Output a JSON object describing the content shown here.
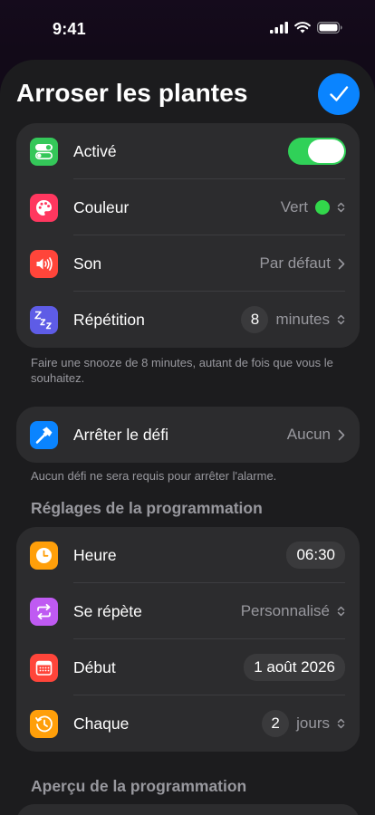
{
  "status": {
    "time": "9:41"
  },
  "header": {
    "title": "Arroser les plantes"
  },
  "settings": {
    "active_label": "Activé",
    "color_label": "Couleur",
    "color_value": "Vert",
    "sound_label": "Son",
    "sound_value": "Par défaut",
    "repeat_label": "Répétition",
    "repeat_number": "8",
    "repeat_unit": "minutes",
    "note": "Faire une snooze de 8 minutes, autant de fois que vous le souhaitez."
  },
  "challenge": {
    "label": "Arrêter le défi",
    "value": "Aucun",
    "note": "Aucun défi ne sera requis pour arrêter l'alarme."
  },
  "schedule": {
    "section_title": "Réglages de la programmation",
    "time_label": "Heure",
    "time_value": "06:30",
    "repeats_label": "Se répète",
    "repeats_value": "Personnalisé",
    "start_label": "Début",
    "start_value": "1 août 2026",
    "every_label": "Chaque",
    "every_number": "2",
    "every_unit": "jours"
  },
  "preview": {
    "section_title": "Aperçu de la programmation"
  },
  "colors": {
    "accent": "#0a84ff",
    "toggle_on": "#30d158",
    "color_dot": "#32d74b",
    "icon_active": "#34c759",
    "icon_color": "#ff375f",
    "icon_sound": "#ff453a",
    "icon_snooze": "#5e5ce6",
    "icon_challenge": "#0a84ff",
    "icon_time": "#ff9f0a",
    "icon_repeat": "#bf5af2",
    "icon_start": "#ff453a",
    "icon_every": "#ff9f0a"
  },
  "icons": {
    "active": "toggles-icon",
    "color": "palette-icon",
    "sound": "speaker-icon",
    "snooze": "zzz-icon",
    "challenge": "hammer-icon",
    "time": "clock-icon",
    "repeats": "repeat-icon",
    "start": "calendar-icon",
    "every": "history-icon"
  }
}
